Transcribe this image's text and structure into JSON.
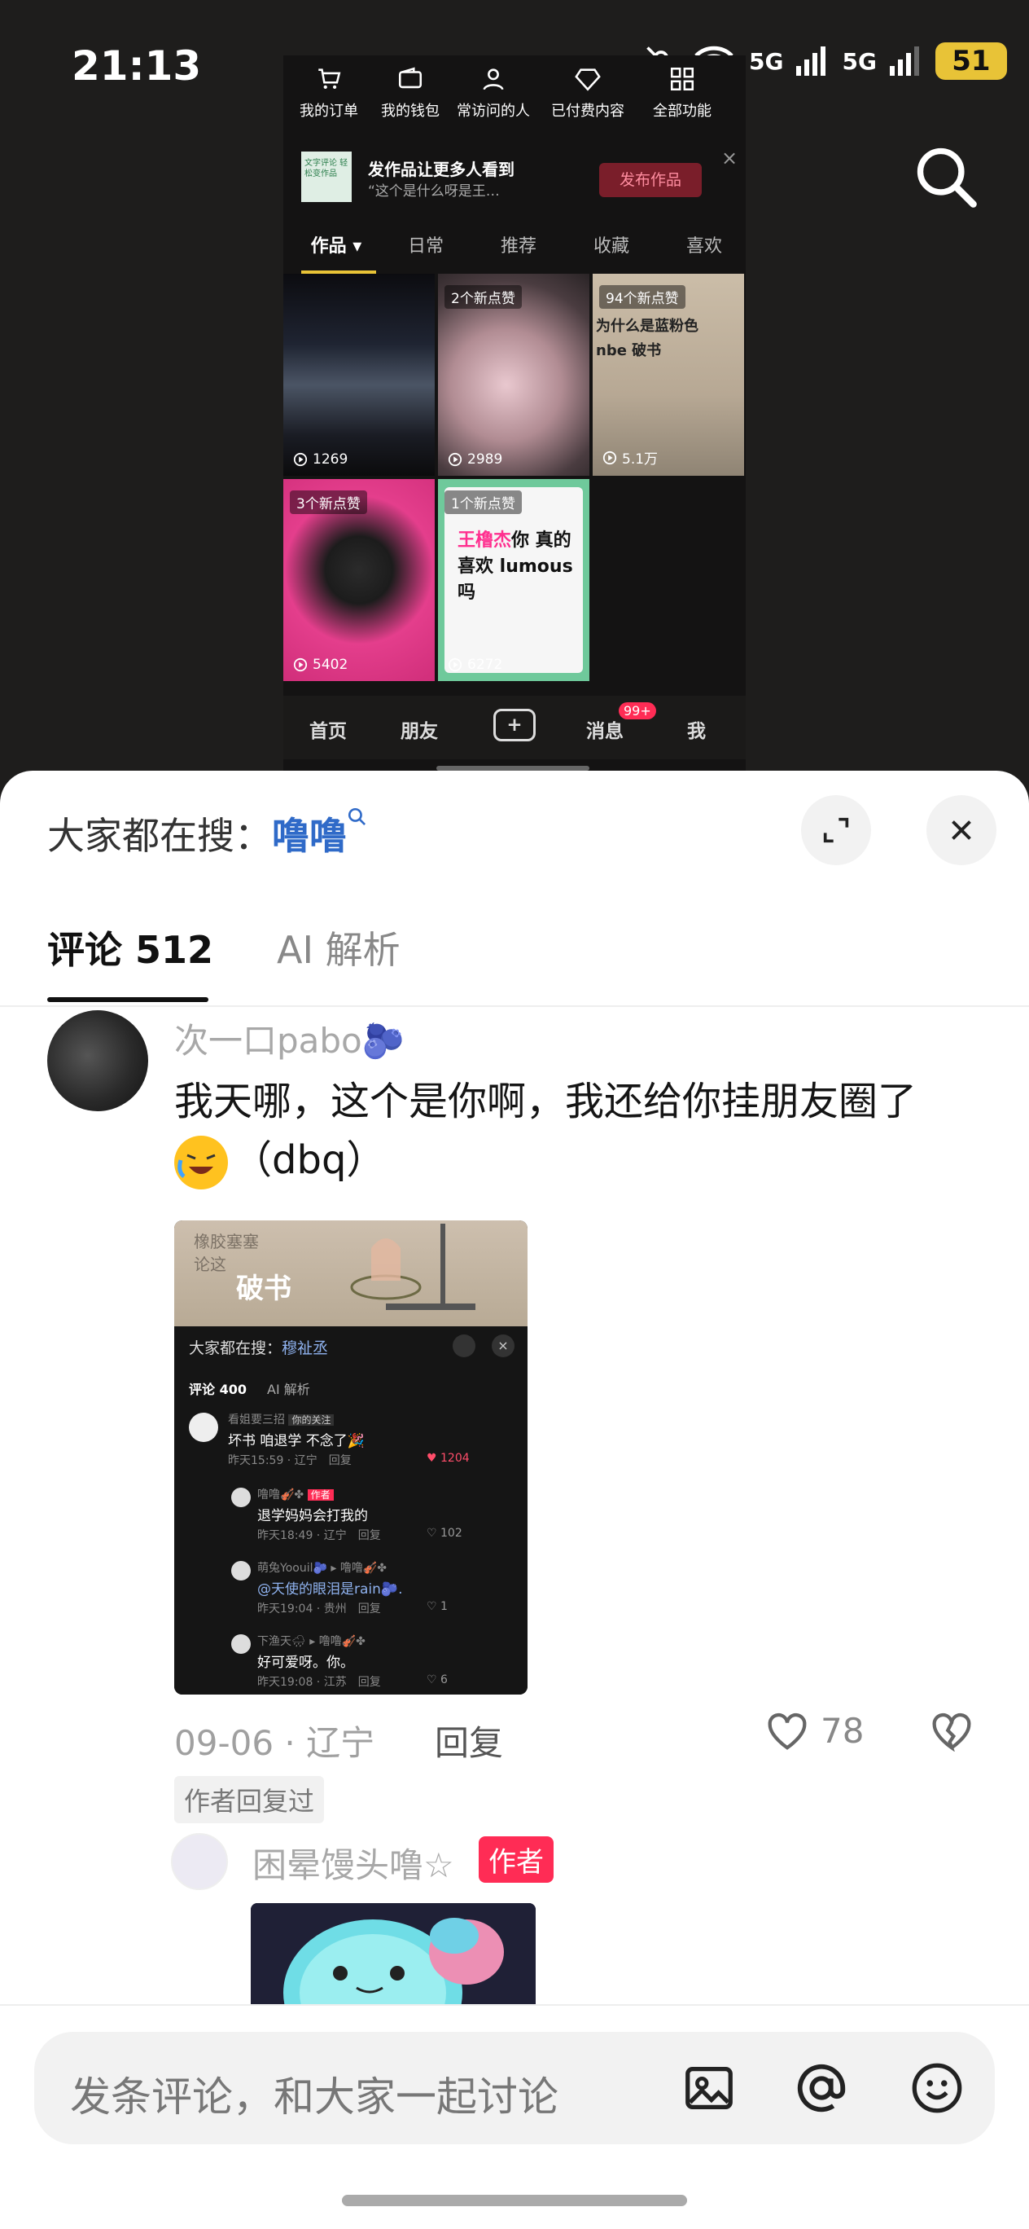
{
  "status_bar": {
    "time": "21:13",
    "network1": "5G",
    "network2": "5G",
    "battery": "51"
  },
  "inset": {
    "tools": [
      {
        "label": "我的订单",
        "icon": "cart-icon"
      },
      {
        "label": "我的钱包",
        "icon": "wallet-icon"
      },
      {
        "label": "常访问的人",
        "icon": "person-icon"
      },
      {
        "label": "已付费内容",
        "icon": "diamond-icon"
      },
      {
        "label": "全部功能",
        "icon": "grid-icon"
      }
    ],
    "promo": {
      "thumb": "文字评论 轻松变作品",
      "title": "发作品让更多人看到",
      "subtitle": "“这个是什么呀是王…",
      "button": "发布作品",
      "close": "×"
    },
    "tabs": [
      "作品 ▾",
      "日常",
      "推荐",
      "收藏",
      "喜欢"
    ],
    "tiles": [
      {
        "badge": "",
        "views": "1269",
        "text": ""
      },
      {
        "badge": "2个新点赞",
        "views": "2989",
        "text": ""
      },
      {
        "badge": "94个新点赞",
        "views": "5.1万",
        "text": "为什么是蓝粉色 nbe 破书"
      },
      {
        "badge": "3个新点赞",
        "views": "5402",
        "text": ""
      },
      {
        "badge": "1个新点赞",
        "views": "6272",
        "text_name": "王橹杰",
        "text_rest": "你 真的喜欢 lumous吗"
      }
    ],
    "nav": {
      "home": "首页",
      "friends": "朋友",
      "plus": "+",
      "messages": "消息",
      "badge": "99+",
      "me": "我"
    }
  },
  "sheet": {
    "hot_label": "大家都在搜：",
    "hot_keyword": "噜噜",
    "tabs": {
      "comments": "评论 512",
      "ai": "AI 解析"
    },
    "comment": {
      "username": "次一口pabo🫐",
      "text": "我天哪，这个是你啊，我还给你挂朋友圈了",
      "text2": "（dbq）",
      "date_loc": "09-06 · 辽宁",
      "reply": "回复",
      "likes": "78",
      "replied_tag": "作者回复过",
      "embedded": {
        "top_text": "破书",
        "top_faint": "橡胶塞塞 论这",
        "search_label": "大家都在搜：",
        "search_kw": "穆祉丞",
        "tab1": "评论 400",
        "tab2": "AI 解析",
        "rows": [
          {
            "name": "看姐要三招",
            "tag": "你的关注",
            "text": "坏书 咱退学 不念了🎉",
            "meta": "昨天15:59 · 辽宁",
            "reply": "回复",
            "likes": "1204"
          },
          {
            "name": "噜噜🎻✤",
            "tag": "作者",
            "text": "退学妈妈会打我的",
            "meta": "昨天18:49 · 辽宁",
            "reply": "回复",
            "likes": "102"
          },
          {
            "name": "萌兔Yoouil🫐 ▸ 噜噜🎻✤",
            "tag": "",
            "text": "@天使的眼泪是rain🫐.",
            "meta": "昨天19:04 · 贵州",
            "reply": "回复",
            "likes": "1"
          },
          {
            "name": "下渔天🌧 ▸ 噜噜🎻✤",
            "tag": "",
            "text": "好可爱呀。你。",
            "meta": "昨天19:08 · 江苏",
            "reply": "回复",
            "likes": "6"
          }
        ]
      }
    },
    "reply_user": "困晕馒头噜☆",
    "author_tag": "作者",
    "input_placeholder": "发条评论，和大家一起讨论"
  }
}
